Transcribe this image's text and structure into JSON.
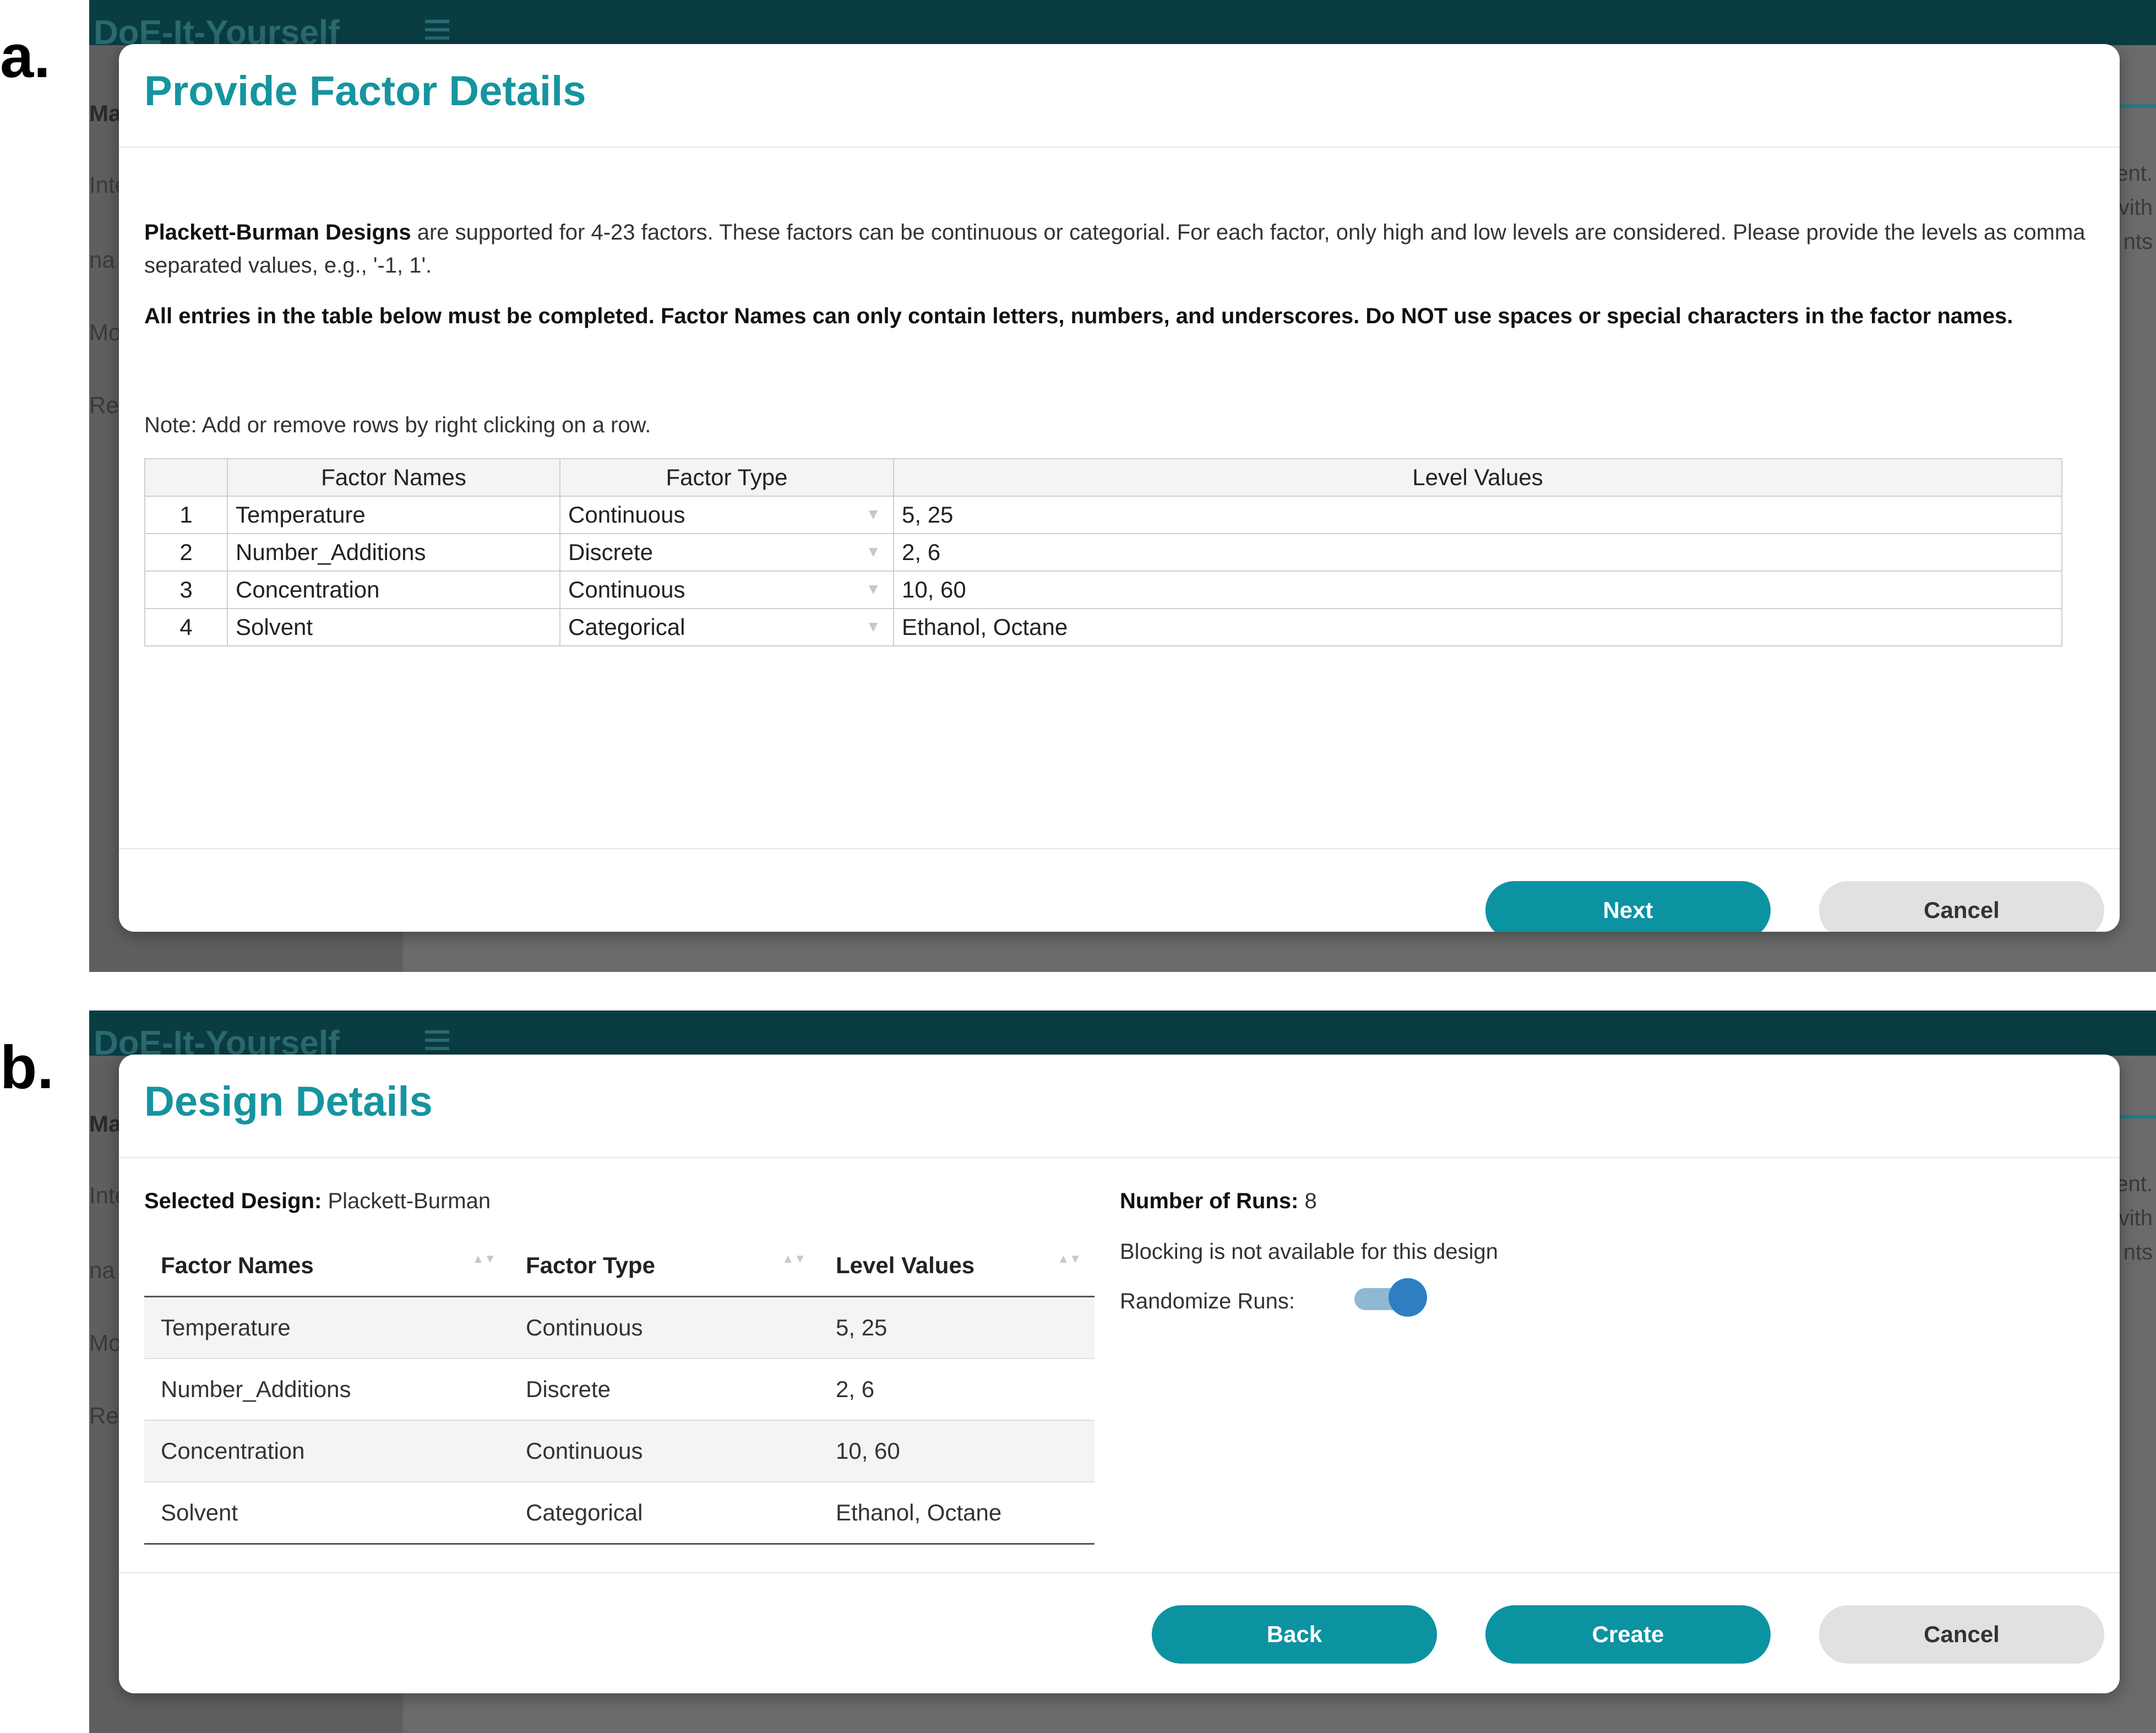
{
  "panel_a": {
    "letter": "a.",
    "background": {
      "app_title": "DoE-It-Yourself",
      "sidebar_fragments": [
        "Mal",
        "Inte",
        "na",
        "Mod",
        "Res"
      ],
      "right_fragments": [
        "ent.",
        "vith",
        "nts"
      ]
    },
    "modal": {
      "title": "Provide Factor Details",
      "intro_bold": "Plackett-Burman Designs",
      "intro_rest": " are supported for 4-23 factors. These factors can be continuous or categorial. For each factor, only high and low levels are considered. Please provide the levels as comma separated values, e.g., '-1, 1'.",
      "warning": "All entries in the table below must be completed. Factor Names can only contain letters, numbers, and underscores. Do NOT use spaces or special characters in the factor names.",
      "note": "Note: Add or remove rows by right clicking on a row.",
      "table": {
        "headers": [
          "",
          "Factor Names",
          "Factor Type",
          "Level Values"
        ],
        "rows": [
          {
            "num": "1",
            "name": "Temperature",
            "type": "Continuous",
            "levels": "5, 25"
          },
          {
            "num": "2",
            "name": "Number_Additions",
            "type": "Discrete",
            "levels": "2, 6"
          },
          {
            "num": "3",
            "name": "Concentration",
            "type": "Continuous",
            "levels": "10, 60"
          },
          {
            "num": "4",
            "name": "Solvent",
            "type": "Categorical",
            "levels": "Ethanol, Octane"
          }
        ],
        "caret_icon": "▼"
      },
      "buttons": {
        "next": "Next",
        "cancel": "Cancel"
      }
    }
  },
  "panel_b": {
    "letter": "b.",
    "background": {
      "app_title": "DoE-It-Yourself",
      "sidebar_fragments": [
        "Mal",
        "Inte",
        "na",
        "Mod",
        "Res"
      ],
      "right_fragments": [
        "ent.",
        "vith",
        "nts"
      ]
    },
    "modal": {
      "title": "Design Details",
      "selected_design_label": "Selected Design:",
      "selected_design_value": " Plackett-Burman",
      "table": {
        "headers": [
          "Factor Names",
          "Factor Type",
          "Level Values"
        ],
        "rows": [
          {
            "name": "Temperature",
            "type": "Continuous",
            "levels": "5, 25"
          },
          {
            "name": "Number_Additions",
            "type": "Discrete",
            "levels": "2, 6"
          },
          {
            "name": "Concentration",
            "type": "Continuous",
            "levels": "10, 60"
          },
          {
            "name": "Solvent",
            "type": "Categorical",
            "levels": "Ethanol, Octane"
          }
        ],
        "sort_icon": "▲▼"
      },
      "runs_label": "Number of Runs:",
      "runs_value": " 8",
      "blocking_text": "Blocking is not available for this design",
      "randomize_label": "Randomize Runs:",
      "randomize_on": true,
      "buttons": {
        "back": "Back",
        "create": "Create",
        "cancel": "Cancel"
      }
    }
  },
  "colors": {
    "accent": "#0c93a2",
    "title": "#1694a0",
    "header_bg": "#0a3d42",
    "toggle_knob": "#2e7fc1",
    "secondary_button": "#e1e1e1"
  }
}
